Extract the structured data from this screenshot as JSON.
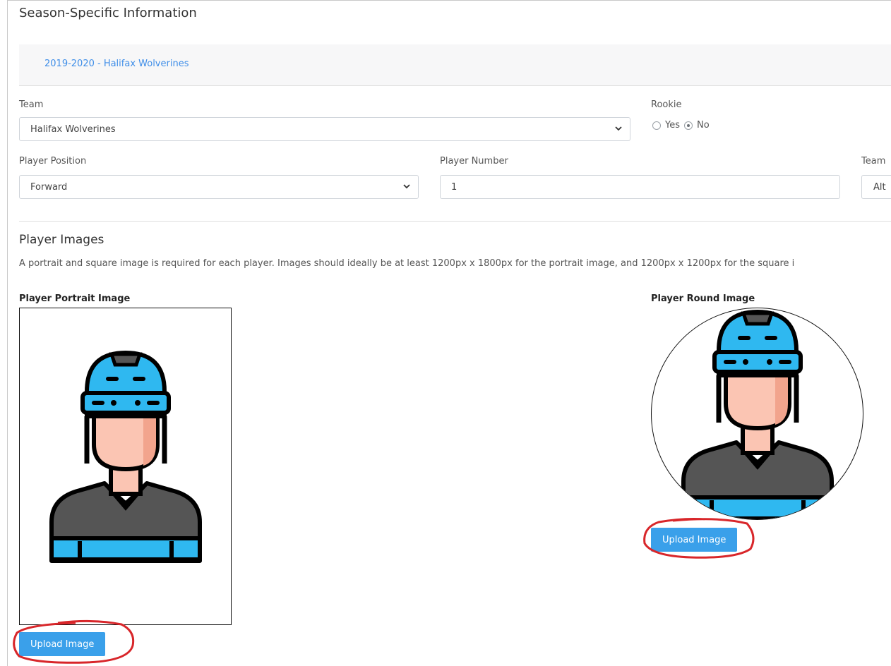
{
  "section": {
    "title": "Season-Specific Information",
    "season_link": "2019-2020 - Halifax Wolverines"
  },
  "form": {
    "team_label": "Team",
    "team_value": "Halifax Wolverines",
    "rookie_label": "Rookie",
    "rookie_yes": "Yes",
    "rookie_no": "No",
    "rookie_selected": "No",
    "position_label": "Player Position",
    "position_value": "Forward",
    "number_label": "Player Number",
    "number_value": "1",
    "team_role_label": "Team",
    "team_role_value": "Alt"
  },
  "images": {
    "heading": "Player Images",
    "description": "A portrait and square image is required for each player. Images should ideally be at least 1200px x 1800px for the portrait image, and 1200px x 1200px for the square i",
    "portrait_label": "Player Portrait Image",
    "round_label": "Player Round Image",
    "upload_label": "Upload Image"
  },
  "icons": [
    "hockey-player-avatar-icon",
    "chevron-down-icon",
    "radio-icon"
  ],
  "colors": {
    "link": "#3f8ee8",
    "button": "#3aa0ea",
    "helmet": "#2fb8f0",
    "annotation": "#d8262a"
  }
}
